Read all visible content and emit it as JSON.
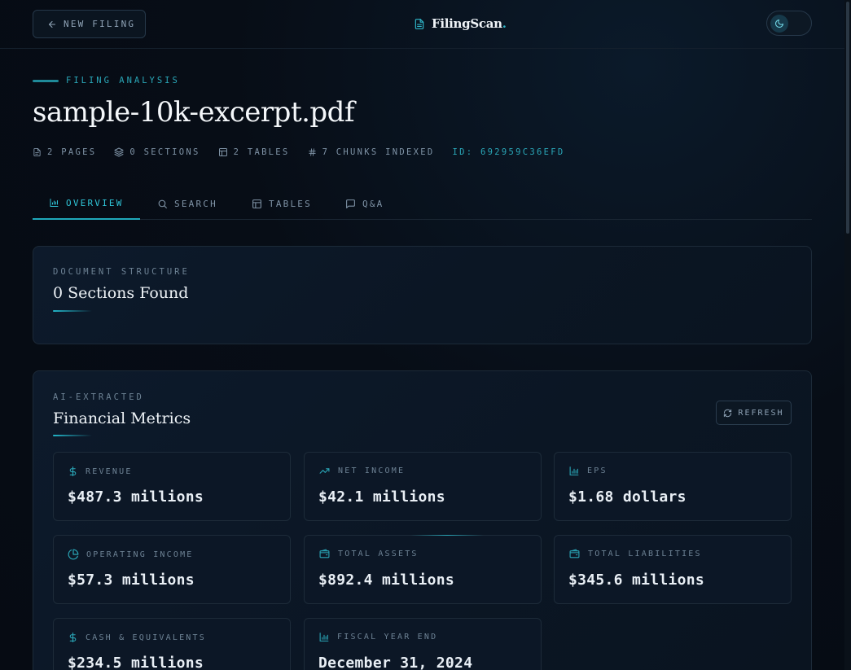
{
  "header": {
    "new_filing_label": "NEW FILING",
    "brand_name": "FilingScan",
    "brand_suffix": ".",
    "theme_icon": "moon-icon"
  },
  "analysis": {
    "eyebrow": "FILING ANALYSIS",
    "file_name": "sample-10k-excerpt.pdf",
    "meta": {
      "pages": "2 PAGES",
      "sections": "0 SECTIONS",
      "tables": "2 TABLES",
      "chunks": "7 CHUNKS INDEXED",
      "id": "ID: 692959C36EFD"
    }
  },
  "tabs": [
    {
      "label": "OVERVIEW",
      "icon": "bar-chart-icon",
      "active": true
    },
    {
      "label": "SEARCH",
      "icon": "search-icon",
      "active": false
    },
    {
      "label": "TABLES",
      "icon": "table-icon",
      "active": false
    },
    {
      "label": "Q&A",
      "icon": "chat-icon",
      "active": false
    }
  ],
  "structure_card": {
    "label": "DOCUMENT STRUCTURE",
    "title": "0 Sections Found"
  },
  "metrics_card": {
    "label": "AI-EXTRACTED",
    "title": "Financial Metrics",
    "refresh_label": "REFRESH",
    "metrics": [
      {
        "label": "REVENUE",
        "value": "$487.3 millions",
        "icon": "dollar-icon"
      },
      {
        "label": "NET INCOME",
        "value": "$42.1 millions",
        "icon": "trending-up-icon"
      },
      {
        "label": "EPS",
        "value": "$1.68 dollars",
        "icon": "bar-chart-icon"
      },
      {
        "label": "OPERATING INCOME",
        "value": "$57.3 millions",
        "icon": "pie-chart-icon"
      },
      {
        "label": "TOTAL ASSETS",
        "value": "$892.4 millions",
        "icon": "wallet-icon"
      },
      {
        "label": "TOTAL LIABILITIES",
        "value": "$345.6 millions",
        "icon": "wallet-icon"
      },
      {
        "label": "CASH & EQUIVALENTS",
        "value": "$234.5 millions",
        "icon": "dollar-icon"
      },
      {
        "label": "FISCAL YEAR END",
        "value": "December 31, 2024",
        "icon": "bar-chart-icon"
      }
    ]
  },
  "colors": {
    "accent": "#2aa7b8",
    "background": "#070d16"
  }
}
